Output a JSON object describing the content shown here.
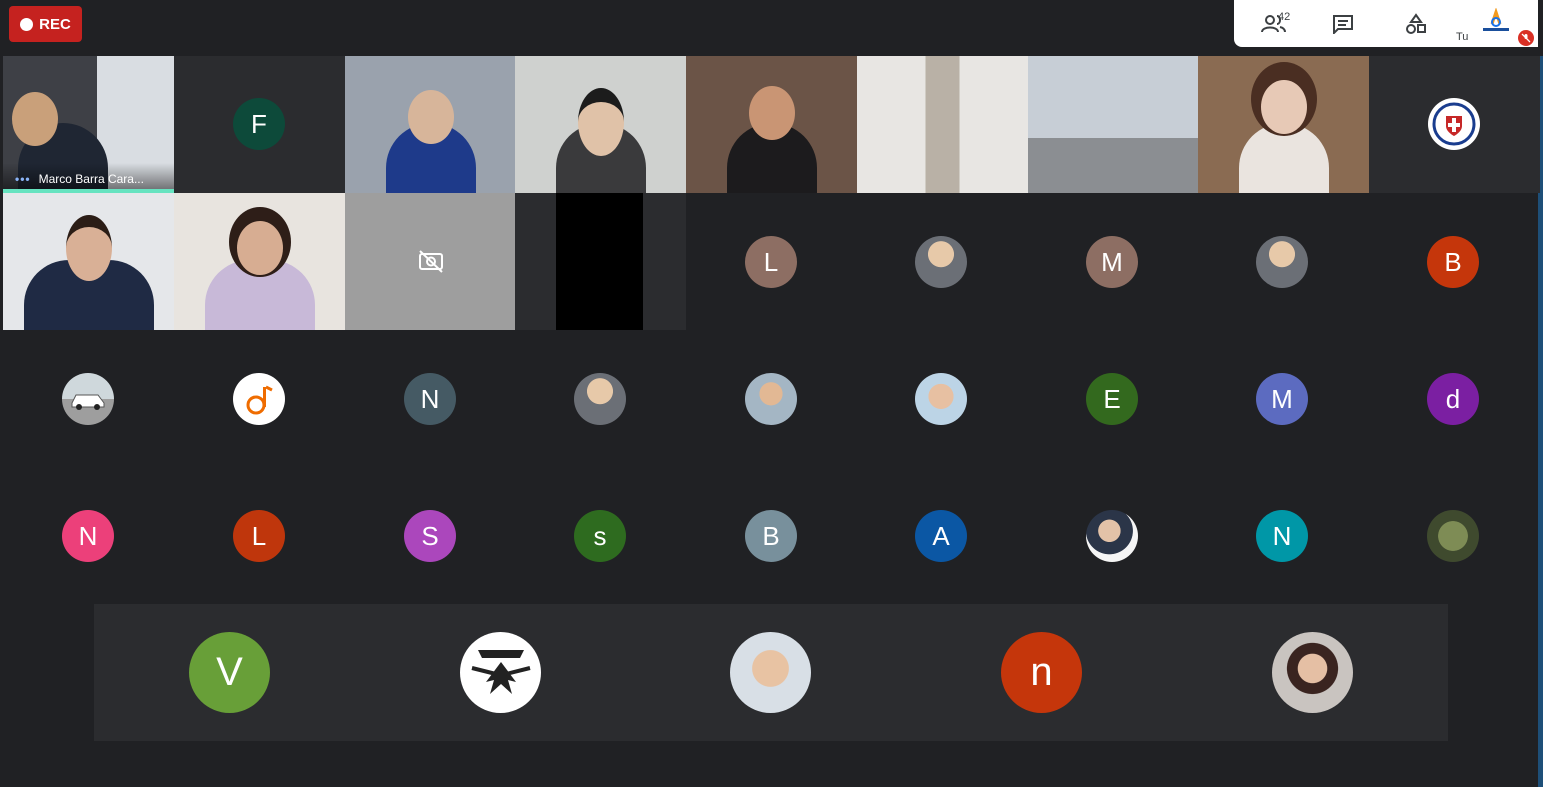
{
  "recording": {
    "label": "REC"
  },
  "top_panel": {
    "participants_count": "42",
    "self_label": "Tu"
  },
  "active_speaker": {
    "name": "Marco Barra Cara..."
  },
  "tiles": [
    {
      "initial": "F",
      "color": "#0d4a3a"
    },
    {
      "initial": "L",
      "color": "#8d6e63"
    },
    {
      "initial": "M",
      "color": "#8d6e63"
    },
    {
      "initial": "B",
      "color": "#c5360b"
    },
    {
      "initial": "N",
      "color": "#455a64"
    },
    {
      "initial": "E",
      "color": "#33691e"
    },
    {
      "initial": "M",
      "color": "#5c6bc0"
    },
    {
      "initial": "d",
      "color": "#7b1fa2"
    },
    {
      "initial": "N",
      "color": "#ec407a"
    },
    {
      "initial": "L",
      "color": "#bf360c"
    },
    {
      "initial": "S",
      "color": "#ab47bc"
    },
    {
      "initial": "s",
      "color": "#2e6b1f"
    },
    {
      "initial": "B",
      "color": "#78909c"
    },
    {
      "initial": "A",
      "color": "#0b57a4"
    },
    {
      "initial": "N",
      "color": "#0097a7"
    },
    {
      "initial": "V",
      "color": "#689f38"
    },
    {
      "initial": "n",
      "color": "#c5360b"
    }
  ]
}
